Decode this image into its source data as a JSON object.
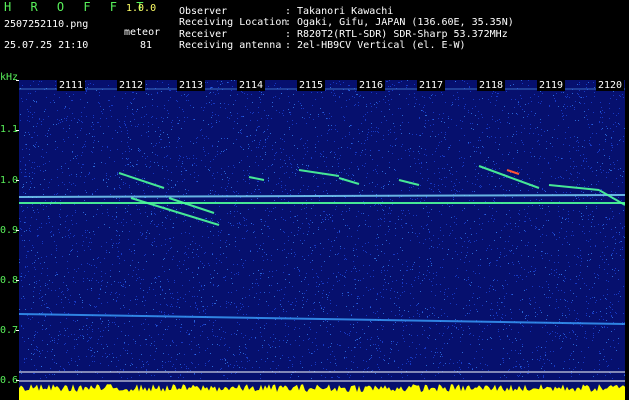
{
  "header": {
    "app_name": "H R O F F T",
    "version": "1.0.0",
    "filename": "2507252110.png",
    "datetime": "25.07.25 21:10",
    "mode_label": "meteor",
    "meteor_count": "81"
  },
  "station": [
    {
      "key": "Observer",
      "value": "Takanori Kawachi"
    },
    {
      "key": "Receiving Location",
      "value": "Ogaki, Gifu, JAPAN (136.60E, 35.35N)"
    },
    {
      "key": "Receiver",
      "value": "R820T2(RTL-SDR) SDR-Sharp 53.372MHz"
    },
    {
      "key": "Receiving antenna",
      "value": "2el-HB9CV Vertical (el. E-W)"
    }
  ],
  "chart_data": {
    "type": "heatmap",
    "ylabel": "kHz",
    "y_ticks": [
      "1.1",
      "1.0",
      "0.9",
      "0.8",
      "0.7",
      "0.6"
    ],
    "x_ticks": [
      "2111",
      "2112",
      "2113",
      "2114",
      "2115",
      "2116",
      "2117",
      "2118",
      "2119",
      "2120"
    ],
    "ylim": [
      0.6,
      1.2
    ],
    "colors": {
      "background": "#06106e",
      "noise": "#1a3fd0",
      "trace": "#4dff9a",
      "peak": "#ff5533",
      "activity": "#ffff00"
    }
  }
}
